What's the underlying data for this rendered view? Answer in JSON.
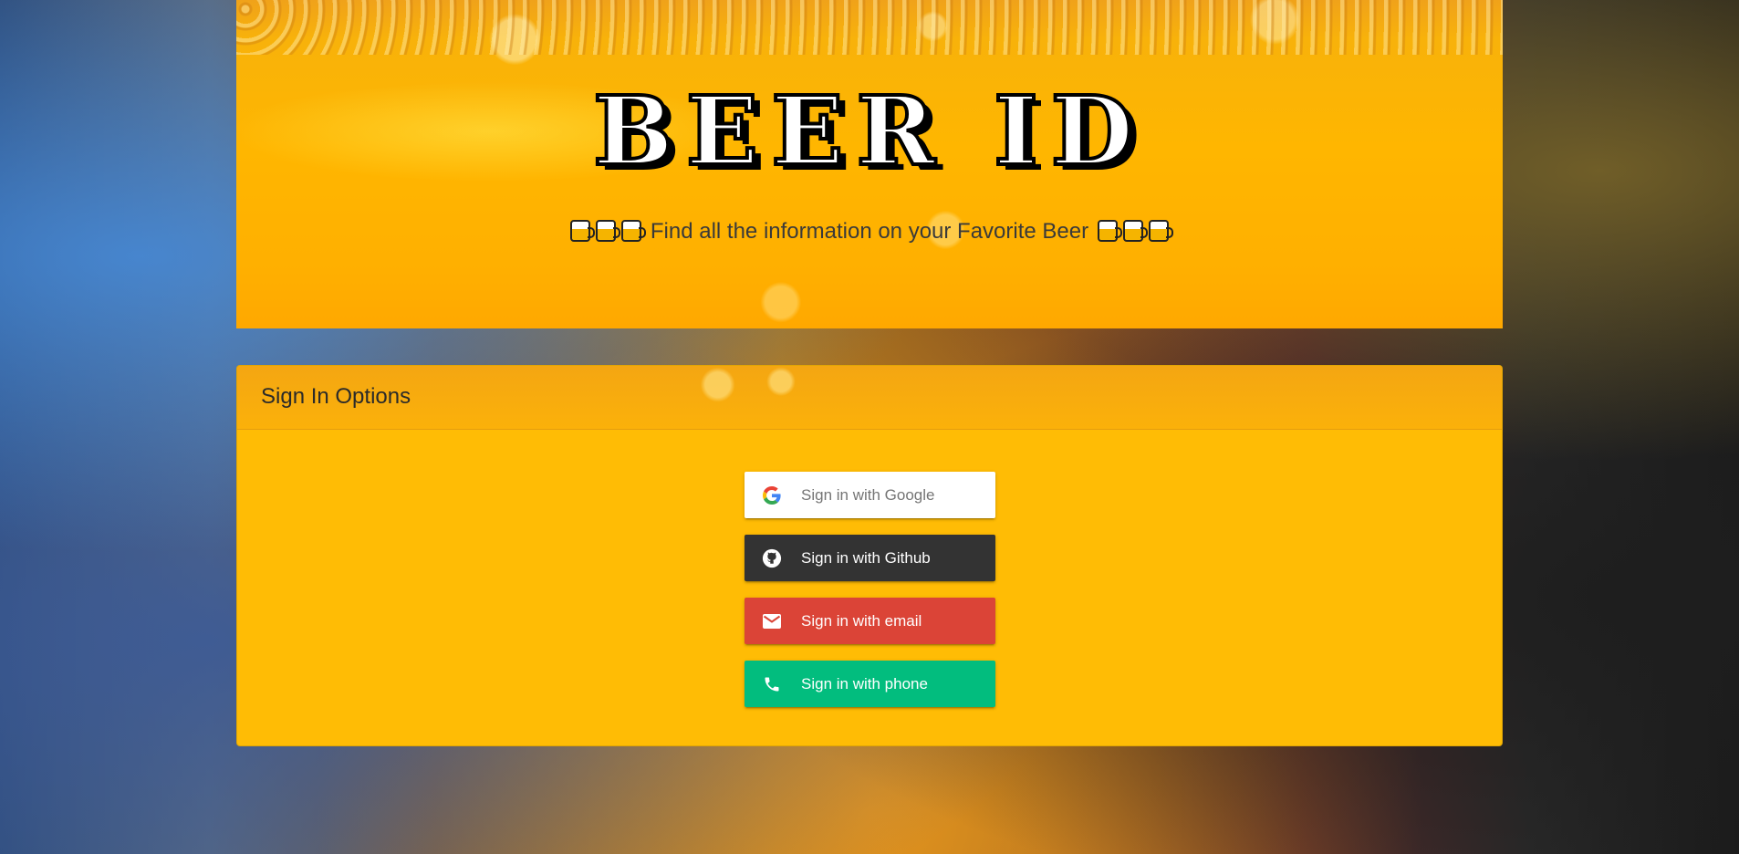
{
  "hero": {
    "title": "BEER ID",
    "subtitle": "Find all the information on your Favorite Beer"
  },
  "card": {
    "header": "Sign In Options"
  },
  "buttons": {
    "google": "Sign in with Google",
    "github": "Sign in with Github",
    "email": "Sign in with email",
    "phone": "Sign in with phone"
  },
  "icons": {
    "google": "google-icon",
    "github": "github-icon",
    "email": "email-icon",
    "phone": "phone-icon",
    "mug": "beer-mug-icon"
  },
  "colors": {
    "google_bg": "#ffffff",
    "github_bg": "#333333",
    "email_bg": "#db4437",
    "phone_bg": "#02bd7e",
    "card_bg": "#ffbc05"
  }
}
